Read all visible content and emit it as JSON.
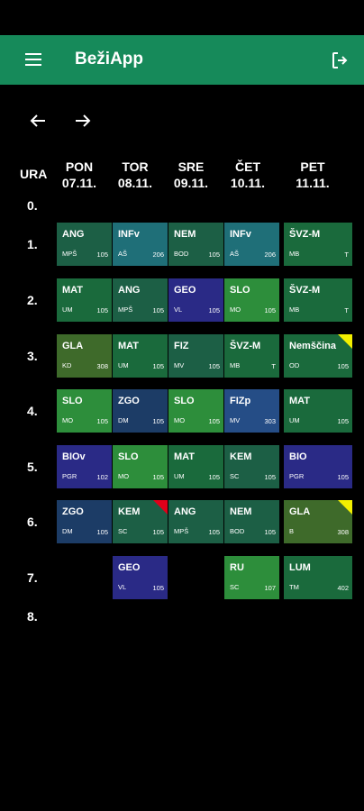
{
  "app": {
    "title": "BežiApp"
  },
  "icons": {
    "menu": "menu-icon",
    "logout": "logout-icon",
    "prev": "arrow-left-icon",
    "next": "arrow-right-icon"
  },
  "header": {
    "ura": "URA"
  },
  "days": [
    {
      "name": "PON",
      "date": "07.11."
    },
    {
      "name": "TOR",
      "date": "08.11."
    },
    {
      "name": "SRE",
      "date": "09.11."
    },
    {
      "name": "ČET",
      "date": "10.11."
    },
    {
      "name": "PET",
      "date": "11.11."
    }
  ],
  "periods": [
    "0.",
    "1.",
    "2.",
    "3.",
    "4.",
    "5.",
    "6.",
    "7.",
    "8."
  ],
  "lessons": [
    {
      "period": 1,
      "day": 0,
      "subject": "ANG",
      "teacher": "MPŠ",
      "room": "105",
      "color": "g-dark"
    },
    {
      "period": 1,
      "day": 1,
      "subject": "INFv",
      "teacher": "AŠ",
      "room": "206",
      "color": "g-teal"
    },
    {
      "period": 1,
      "day": 2,
      "subject": "NEM",
      "teacher": "BOD",
      "room": "105",
      "color": "g-dark"
    },
    {
      "period": 1,
      "day": 3,
      "subject": "INFv",
      "teacher": "AŠ",
      "room": "206",
      "color": "g-teal"
    },
    {
      "period": 1,
      "day": 4,
      "subject": "ŠVZ-M",
      "teacher": "MB",
      "room": "T",
      "color": "g-green"
    },
    {
      "period": 2,
      "day": 0,
      "subject": "MAT",
      "teacher": "UM",
      "room": "105",
      "color": "g-green"
    },
    {
      "period": 2,
      "day": 1,
      "subject": "ANG",
      "teacher": "MPŠ",
      "room": "105",
      "color": "g-dark"
    },
    {
      "period": 2,
      "day": 2,
      "subject": "GEO",
      "teacher": "VL",
      "room": "105",
      "color": "g-blue"
    },
    {
      "period": 2,
      "day": 3,
      "subject": "SLO",
      "teacher": "MO",
      "room": "105",
      "color": "g-bright"
    },
    {
      "period": 2,
      "day": 4,
      "subject": "ŠVZ-M",
      "teacher": "MB",
      "room": "T",
      "color": "g-green"
    },
    {
      "period": 3,
      "day": 0,
      "subject": "GLA",
      "teacher": "KD",
      "room": "308",
      "color": "g-olive"
    },
    {
      "period": 3,
      "day": 1,
      "subject": "MAT",
      "teacher": "UM",
      "room": "105",
      "color": "g-green"
    },
    {
      "period": 3,
      "day": 2,
      "subject": "FIZ",
      "teacher": "MV",
      "room": "105",
      "color": "g-dark"
    },
    {
      "period": 3,
      "day": 3,
      "subject": "ŠVZ-M",
      "teacher": "MB",
      "room": "T",
      "color": "g-green"
    },
    {
      "period": 3,
      "day": 4,
      "subject": "Nemščina",
      "teacher": "OD",
      "room": "105",
      "color": "g-green",
      "flag": "yellow"
    },
    {
      "period": 4,
      "day": 0,
      "subject": "SLO",
      "teacher": "MO",
      "room": "105",
      "color": "g-bright"
    },
    {
      "period": 4,
      "day": 1,
      "subject": "ZGO",
      "teacher": "DM",
      "room": "105",
      "color": "g-navy"
    },
    {
      "period": 4,
      "day": 2,
      "subject": "SLO",
      "teacher": "MO",
      "room": "105",
      "color": "g-bright"
    },
    {
      "period": 4,
      "day": 3,
      "subject": "FIZp",
      "teacher": "MV",
      "room": "303",
      "color": "g-blueteal"
    },
    {
      "period": 4,
      "day": 4,
      "subject": "MAT",
      "teacher": "UM",
      "room": "105",
      "color": "g-green"
    },
    {
      "period": 5,
      "day": 0,
      "subject": "BIOv",
      "teacher": "PGR",
      "room": "102",
      "color": "g-blue"
    },
    {
      "period": 5,
      "day": 1,
      "subject": "SLO",
      "teacher": "MO",
      "room": "105",
      "color": "g-bright"
    },
    {
      "period": 5,
      "day": 2,
      "subject": "MAT",
      "teacher": "UM",
      "room": "105",
      "color": "g-green"
    },
    {
      "period": 5,
      "day": 3,
      "subject": "KEM",
      "teacher": "SC",
      "room": "105",
      "color": "g-dark"
    },
    {
      "period": 5,
      "day": 4,
      "subject": "BIO",
      "teacher": "PGR",
      "room": "105",
      "color": "g-blue"
    },
    {
      "period": 6,
      "day": 0,
      "subject": "ZGO",
      "teacher": "DM",
      "room": "105",
      "color": "g-navy"
    },
    {
      "period": 6,
      "day": 1,
      "subject": "KEM",
      "teacher": "SC",
      "room": "105",
      "color": "g-dark",
      "flag": "red"
    },
    {
      "period": 6,
      "day": 2,
      "subject": "ANG",
      "teacher": "MPŠ",
      "room": "105",
      "color": "g-dark"
    },
    {
      "period": 6,
      "day": 3,
      "subject": "NEM",
      "teacher": "BOD",
      "room": "105",
      "color": "g-dark"
    },
    {
      "period": 6,
      "day": 4,
      "subject": "GLA",
      "teacher": "B",
      "room": "308",
      "color": "g-olive",
      "flag": "yellow"
    },
    {
      "period": 7,
      "day": 1,
      "subject": "GEO",
      "teacher": "VL",
      "room": "105",
      "color": "g-blue"
    },
    {
      "period": 7,
      "day": 3,
      "subject": "RU",
      "teacher": "SC",
      "room": "107",
      "color": "g-bright"
    },
    {
      "period": 7,
      "day": 4,
      "subject": "LUM",
      "teacher": "TM",
      "room": "402",
      "color": "g-green"
    }
  ]
}
